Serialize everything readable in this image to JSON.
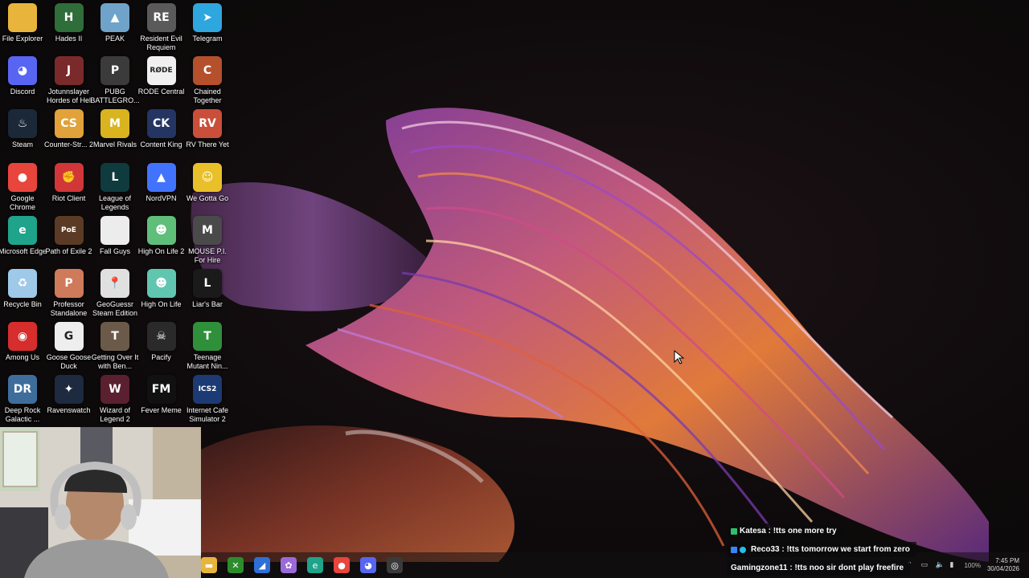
{
  "desktop": {
    "icons": [
      {
        "label": "File Explorer",
        "icon": "folder-icon",
        "color": "#e9b43c",
        "glyph": ""
      },
      {
        "label": "Hades II",
        "icon": "hades-icon",
        "color": "#2f6d3a",
        "glyph": "H"
      },
      {
        "label": "PEAK",
        "icon": "peak-icon",
        "color": "#6fa3c9",
        "glyph": "▲"
      },
      {
        "label": "Resident Evil Requiem",
        "icon": "resident-evil-icon",
        "color": "#5a5a5a",
        "glyph": "RE"
      },
      {
        "label": "Telegram",
        "icon": "telegram-icon",
        "color": "#2ea6de",
        "glyph": "➤"
      },
      {
        "label": "Discord",
        "icon": "discord-icon",
        "color": "#5865f2",
        "glyph": "◕"
      },
      {
        "label": "Jotunnslayer Hordes of Hel",
        "icon": "jotunnslayer-icon",
        "color": "#7a2a2a",
        "glyph": "J"
      },
      {
        "label": "PUBG BATTLEGRO...",
        "icon": "pubg-icon",
        "color": "#3b3b3b",
        "glyph": "P"
      },
      {
        "label": "RODE Central",
        "icon": "rode-icon",
        "color": "#f0f0f0",
        "glyph": "RØDE"
      },
      {
        "label": "Chained Together",
        "icon": "chained-together-icon",
        "color": "#b5502c",
        "glyph": "C"
      },
      {
        "label": "Steam",
        "icon": "steam-icon",
        "color": "#1b2838",
        "glyph": "♨"
      },
      {
        "label": "Counter-Str... 2",
        "icon": "counter-strike-icon",
        "color": "#e1a23b",
        "glyph": "CS"
      },
      {
        "label": "Marvel Rivals",
        "icon": "marvel-rivals-icon",
        "color": "#d9b41f",
        "glyph": "M"
      },
      {
        "label": "Content King",
        "icon": "content-king-icon",
        "color": "#243463",
        "glyph": "CK"
      },
      {
        "label": "RV There Yet",
        "icon": "rv-there-yet-icon",
        "color": "#c94f3a",
        "glyph": "RV"
      },
      {
        "label": "Google Chrome",
        "icon": "chrome-icon",
        "color": "#e8453c",
        "glyph": "●"
      },
      {
        "label": "Riot Client",
        "icon": "riot-client-icon",
        "color": "#d13639",
        "glyph": "✊"
      },
      {
        "label": "League of Legends",
        "icon": "league-icon",
        "color": "#0f3b3e",
        "glyph": "L"
      },
      {
        "label": "NordVPN",
        "icon": "nordvpn-icon",
        "color": "#4273ff",
        "glyph": "▲"
      },
      {
        "label": "We Gotta Go",
        "icon": "we-gotta-go-icon",
        "color": "#e9c02a",
        "glyph": "☺"
      },
      {
        "label": "Microsoft Edge",
        "icon": "edge-icon",
        "color": "#1fa38a",
        "glyph": "e"
      },
      {
        "label": "Path of Exile 2",
        "icon": "path-of-exile-icon",
        "color": "#5b3b25",
        "glyph": "PoE"
      },
      {
        "label": "Fall Guys",
        "icon": "fall-guys-icon",
        "color": "#ececec",
        "glyph": ""
      },
      {
        "label": "High On Life 2",
        "icon": "high-on-life-2-icon",
        "color": "#5fbf7a",
        "glyph": "☻"
      },
      {
        "label": "MOUSE P.I. For Hire",
        "icon": "mouse-pi-icon",
        "color": "#4a4a4a",
        "glyph": "M"
      },
      {
        "label": "Recycle Bin",
        "icon": "recycle-bin-icon",
        "color": "#9ec9e8",
        "glyph": "♻"
      },
      {
        "label": "Professor Standalone",
        "icon": "professor-icon",
        "color": "#cf7a5a",
        "glyph": "P"
      },
      {
        "label": "GeoGuessr Steam Edition",
        "icon": "geoguessr-icon",
        "color": "#e0e0e0",
        "glyph": "📍"
      },
      {
        "label": "High On Life",
        "icon": "high-on-life-icon",
        "color": "#60c6b0",
        "glyph": "☻"
      },
      {
        "label": "Liar's Bar",
        "icon": "liars-bar-icon",
        "color": "#1a1a1a",
        "glyph": "L"
      },
      {
        "label": "Among Us",
        "icon": "among-us-icon",
        "color": "#d62d2d",
        "glyph": "◉"
      },
      {
        "label": "Goose Goose Duck",
        "icon": "goose-goose-duck-icon",
        "color": "#eeeeee",
        "glyph": "G"
      },
      {
        "label": "Getting Over It with Ben...",
        "icon": "getting-over-it-icon",
        "color": "#6b5a4a",
        "glyph": "T"
      },
      {
        "label": "Pacify",
        "icon": "pacify-icon",
        "color": "#2a2a2a",
        "glyph": "☠"
      },
      {
        "label": "Teenage Mutant Nin...",
        "icon": "tmnt-icon",
        "color": "#2f8f3a",
        "glyph": "T"
      },
      {
        "label": "Deep Rock Galactic ...",
        "icon": "deep-rock-galactic-icon",
        "color": "#3f6d9b",
        "glyph": "DR"
      },
      {
        "label": "Ravenswatch",
        "icon": "ravenswatch-icon",
        "color": "#1d2a3f",
        "glyph": "✦"
      },
      {
        "label": "Wizard of Legend 2",
        "icon": "wizard-of-legend-icon",
        "color": "#5a2030",
        "glyph": "W"
      },
      {
        "label": "Fever Meme",
        "icon": "fever-meme-icon",
        "color": "#111111",
        "glyph": "FM"
      },
      {
        "label": "Internet Cafe Simulator 2",
        "icon": "internet-cafe-icon",
        "color": "#1c3a73",
        "glyph": "ICS2"
      }
    ]
  },
  "taskbar": {
    "apps": [
      {
        "icon": "file-explorer-taskbar-icon",
        "color": "#e9b43c",
        "glyph": "▬"
      },
      {
        "icon": "xbox-taskbar-icon",
        "color": "#2c8c2c",
        "glyph": "✕"
      },
      {
        "icon": "visual-studio-taskbar-icon",
        "color": "#2e6fd6",
        "glyph": "◢"
      },
      {
        "icon": "copilot-taskbar-icon",
        "color": "#9b6ad9",
        "glyph": "✿"
      },
      {
        "icon": "edge-taskbar-icon",
        "color": "#1fa38a",
        "glyph": "e"
      },
      {
        "icon": "chrome-taskbar-icon",
        "color": "#e8453c",
        "glyph": "●"
      },
      {
        "icon": "discord-taskbar-icon",
        "color": "#5865f2",
        "glyph": "◕"
      },
      {
        "icon": "obs-taskbar-icon",
        "color": "#3a3a3a",
        "glyph": "◎"
      }
    ],
    "tray": {
      "battery": "100%",
      "time": "7:45 PM",
      "date": "30/04/2026"
    }
  },
  "chat": {
    "messages": [
      {
        "user": "Katesa",
        "text": "!tts one more try"
      },
      {
        "user": "Reco33",
        "text": "!tts tomorrow we start from zero"
      },
      {
        "user": "Gamingzone11",
        "text": "!tts noo sir dont play freefire"
      }
    ]
  }
}
